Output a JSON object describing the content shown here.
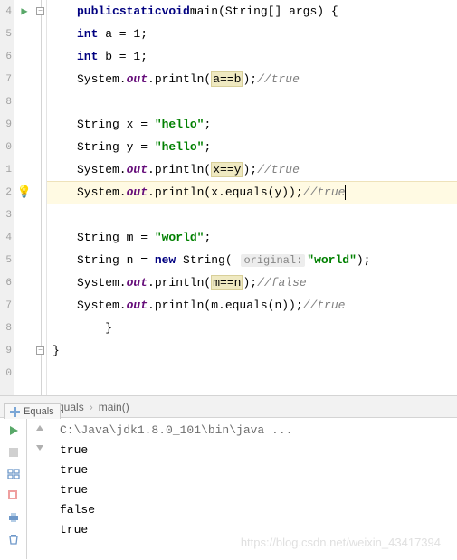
{
  "editor": {
    "line_numbers": [
      "4",
      "5",
      "6",
      "7",
      "8",
      "9",
      "0",
      "1",
      "2",
      "3",
      "4",
      "5",
      "6",
      "7",
      "8",
      "9",
      "0"
    ],
    "code": {
      "l0": {
        "kw_public": "public",
        "kw_static": "static",
        "kw_void": "void",
        "name": "main",
        "params": "(String[] args) {"
      },
      "l1": {
        "kw_int": "int",
        "rest": " a = 1;"
      },
      "l2": {
        "kw_int": "int",
        "rest": " b = 1;"
      },
      "l3": {
        "sys": "System.",
        "out": "out",
        "dot": ".println(",
        "hl": "a==b",
        "close": ");",
        "comment": "//true"
      },
      "l5": {
        "pre": "String x = ",
        "str": "\"hello\"",
        "post": ";"
      },
      "l6": {
        "pre": "String y = ",
        "str": "\"hello\"",
        "post": ";"
      },
      "l7": {
        "sys": "System.",
        "out": "out",
        "dot": ".println(",
        "hl": "x==y",
        "close": ");",
        "comment": "//true"
      },
      "l8": {
        "sys": "System.",
        "out": "out",
        "dot": ".println(x.equals(y));",
        "comment": "//true"
      },
      "l10": {
        "pre": "String m = ",
        "str": "\"world\"",
        "post": ";"
      },
      "l11": {
        "pre": "String n = ",
        "kw": "new",
        "mid": " String( ",
        "hint": "original:",
        "str": "\"world\"",
        "post": ");"
      },
      "l12": {
        "sys": "System.",
        "out": "out",
        "dot": ".println(",
        "hl": "m==n",
        "close": ");",
        "comment": "//false"
      },
      "l13": {
        "sys": "System.",
        "out": "out",
        "dot": ".println(m.equals(n));",
        "comment": "//true"
      },
      "l14": "    }",
      "l15": "}"
    }
  },
  "breadcrumb": {
    "class": "Equals",
    "method": "main()"
  },
  "run_tab": "Equals",
  "console": {
    "cmd": "C:\\Java\\jdk1.8.0_101\\bin\\java ...",
    "out": [
      "true",
      "true",
      "true",
      "false",
      "true"
    ]
  },
  "watermark": "https://blog.csdn.net/weixin_43417394"
}
